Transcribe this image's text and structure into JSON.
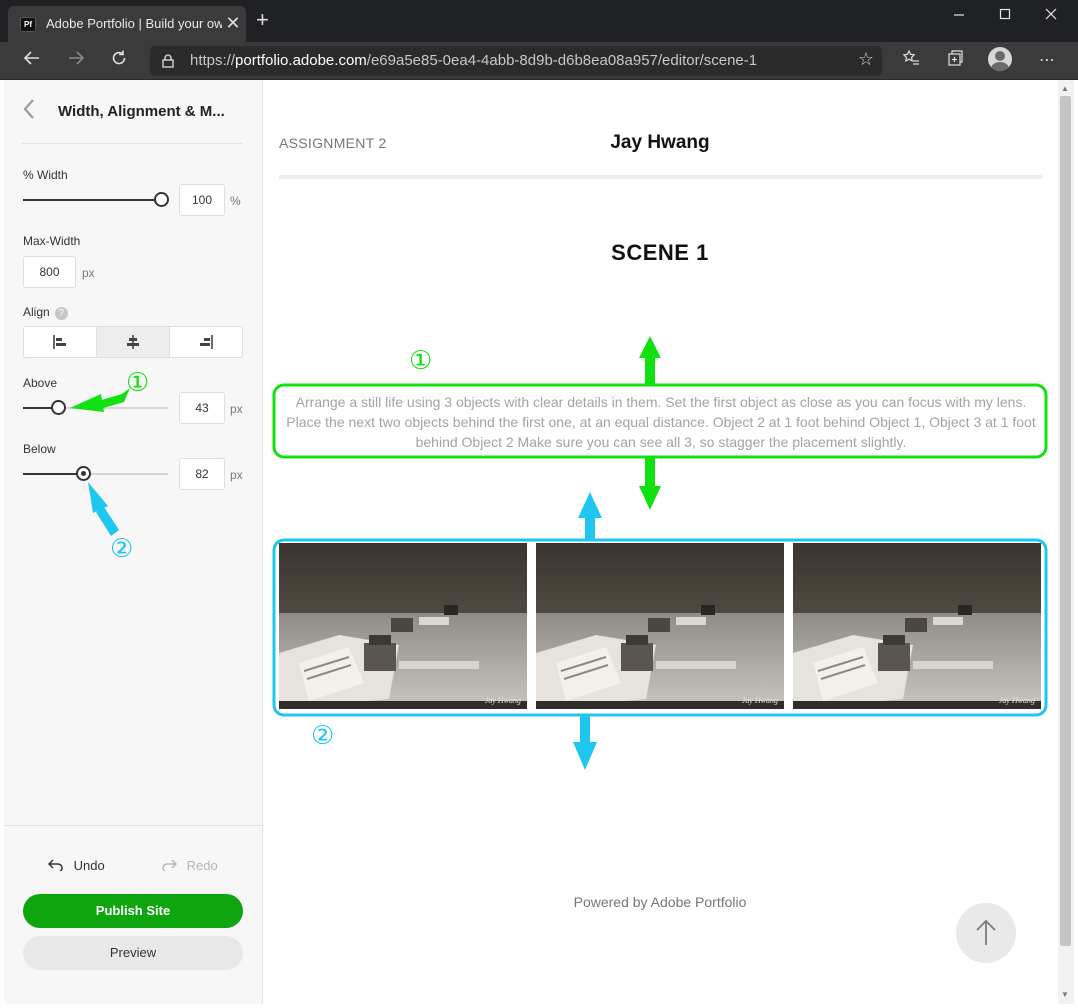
{
  "browser": {
    "tab_title": "Adobe Portfolio | Build your own",
    "tab_favicon_text": "Pf",
    "new_tab_symbol": "+",
    "close_symbol": "✕",
    "url_prefix": "https://",
    "url_host": "portfolio.adobe.com",
    "url_path": "/e69a5e85-0ea4-4abb-8d9b-d6b8ea08a957/editor/scene-1",
    "more_symbol": "⋯"
  },
  "panel": {
    "title": "Width, Alignment & M...",
    "width_label": "% Width",
    "width_value": "100",
    "width_unit": "%",
    "width_fraction": 1.0,
    "max_width_label": "Max-Width",
    "max_width_value": "800",
    "max_width_unit": "px",
    "align_label": "Align",
    "align_help": "?",
    "align_selected": "center",
    "above_label": "Above",
    "above_value": "43",
    "above_unit": "px",
    "below_label": "Below",
    "below_value": "82",
    "below_unit": "px",
    "undo_label": "Undo",
    "redo_label": "Redo",
    "publish_label": "Publish Site",
    "preview_label": "Preview"
  },
  "site": {
    "nav_item": "ASSIGNMENT 2",
    "title": "Jay Hwang",
    "scene_title": "SCENE 1",
    "description": "Arrange a still life using 3 objects with clear details in them. Set the first object as close as you can focus with my lens. Place the next two objects behind the first one, at an equal distance. Object 2 at 1 foot behind Object 1, Object 3 at 1 foot behind Object 2 Make sure you can see all 3, so stagger the placement slightly.",
    "photo_watermark": "Jay Hwang",
    "footer": "Powered by Adobe Portfolio"
  },
  "annotations": {
    "label_1": "①",
    "label_2": "②",
    "color_1": "#11e011",
    "color_2": "#1fc6ef"
  }
}
